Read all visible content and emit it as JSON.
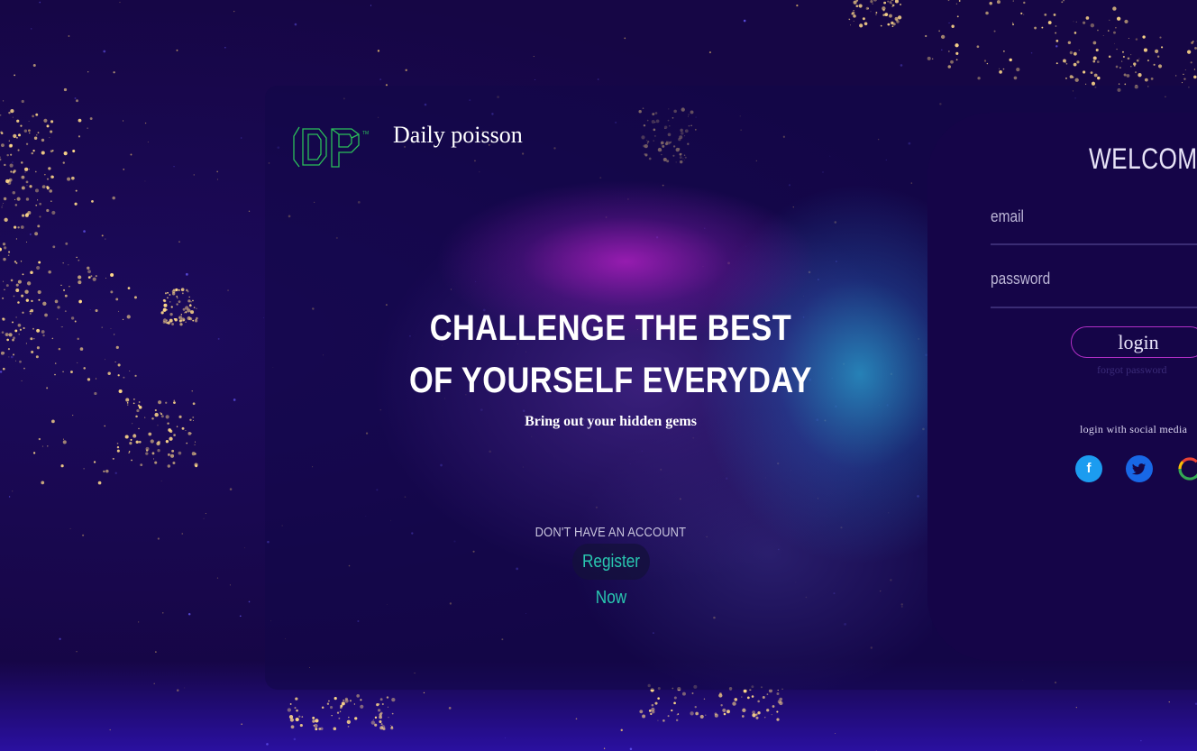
{
  "brand": {
    "name": "Daily poisson",
    "logo_icon": "dp-logo-icon",
    "accent": "#2bbf5a"
  },
  "hero": {
    "headline_line1": "CHALLENGE THE BEST",
    "headline_line2": "OF YOURSELF EVERYDAY",
    "tagline": "Bring out your hidden gems",
    "no_account": "DON'T HAVE AN ACCOUNT",
    "register": "Register Now"
  },
  "login": {
    "title": "WELCOME",
    "email_placeholder": "email",
    "password_placeholder": "password",
    "button": "login",
    "forgot": "forgot password",
    "social_label": "login with social media",
    "social": [
      "facebook-icon",
      "twitter-icon",
      "google-icon"
    ],
    "accent": "#b22fc7"
  },
  "colors": {
    "background": "#160645",
    "register_text": "#29c7b0",
    "facebook": "#1c9cf0",
    "twitter": "#1868e6"
  }
}
